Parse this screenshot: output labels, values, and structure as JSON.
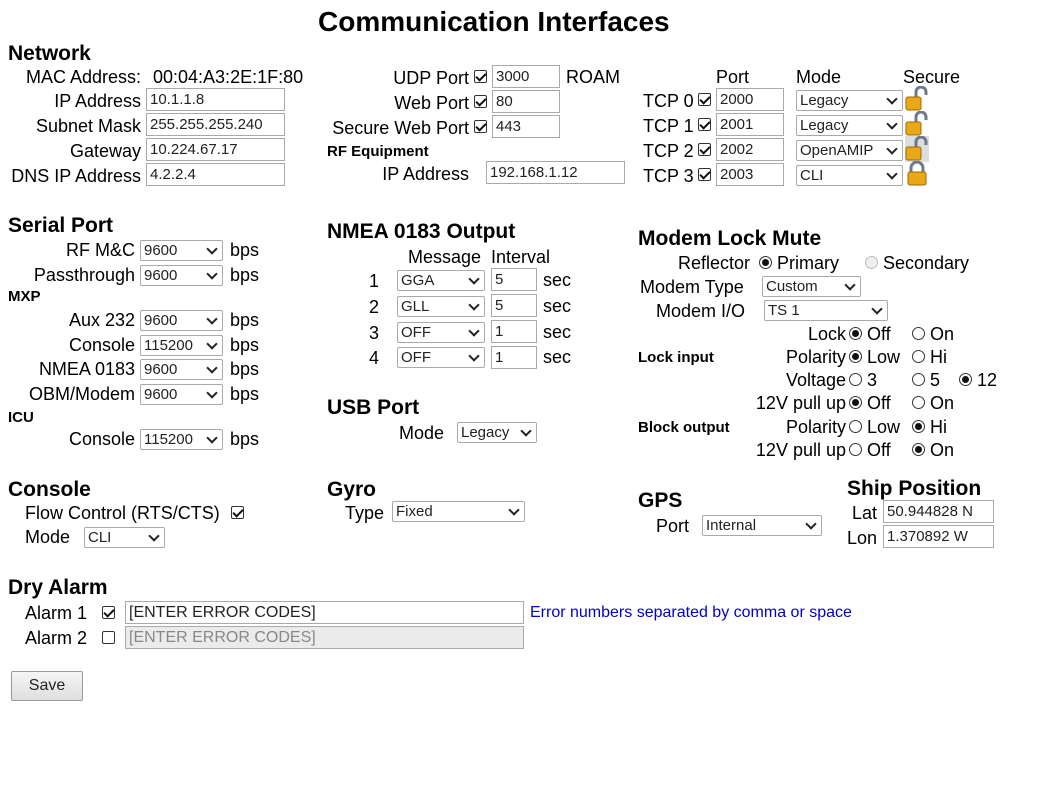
{
  "title": "Communication Interfaces",
  "network": {
    "heading": "Network",
    "mac_label": "MAC Address:",
    "mac_value": "00:04:A3:2E:1F:80",
    "ip_label": "IP Address",
    "ip_value": "10.1.1.8",
    "subnet_label": "Subnet Mask",
    "subnet_value": "255.255.255.240",
    "gateway_label": "Gateway",
    "gateway_value": "10.224.67.17",
    "dns_label": "DNS IP Address",
    "dns_value": "4.2.2.4",
    "udp_label": "UDP Port",
    "udp_value": "3000",
    "udp_checked": true,
    "roam_label": "ROAM",
    "web_label": "Web Port",
    "web_value": "80",
    "web_checked": true,
    "secure_web_label": "Secure Web Port",
    "secure_web_value": "443",
    "secure_web_checked": true,
    "rf_heading": "RF Equipment",
    "rf_ip_label": "IP Address",
    "rf_ip_value": "192.168.1.12"
  },
  "tcp": {
    "port_header": "Port",
    "mode_header": "Mode",
    "secure_header": "Secure",
    "rows": [
      {
        "label": "TCP 0",
        "checked": true,
        "port": "2000",
        "mode": "Legacy",
        "lock_icon": "unlocked-icon"
      },
      {
        "label": "TCP 1",
        "checked": true,
        "port": "2001",
        "mode": "Legacy",
        "lock_icon": "unlocked-icon"
      },
      {
        "label": "TCP 2",
        "checked": true,
        "port": "2002",
        "mode": "OpenAMIP",
        "lock_icon": "unlocked-disabled-icon"
      },
      {
        "label": "TCP 3",
        "checked": true,
        "port": "2003",
        "mode": "CLI",
        "lock_icon": "locked-icon"
      }
    ]
  },
  "serial": {
    "heading": "Serial Port",
    "rfmc_label": "RF M&C",
    "rfmc_value": "9600",
    "pass_label": "Passthrough",
    "pass_value": "9600",
    "mxp_heading": "MXP",
    "aux_label": "Aux 232",
    "aux_value": "9600",
    "console_label": "Console",
    "console_value": "115200",
    "nmea_label": "NMEA 0183",
    "nmea_value": "9600",
    "obm_label": "OBM/Modem",
    "obm_value": "9600",
    "icu_heading": "ICU",
    "icu_console_label": "Console",
    "icu_console_value": "115200",
    "unit": "bps"
  },
  "nmea": {
    "heading": "NMEA 0183 Output",
    "message_header": "Message",
    "interval_header": "Interval",
    "unit": "sec",
    "rows": [
      {
        "num": "1",
        "message": "GGA",
        "interval": "5"
      },
      {
        "num": "2",
        "message": "GLL",
        "interval": "5"
      },
      {
        "num": "3",
        "message": "OFF",
        "interval": "1"
      },
      {
        "num": "4",
        "message": "OFF",
        "interval": "1"
      }
    ]
  },
  "usb": {
    "heading": "USB Port",
    "mode_label": "Mode",
    "mode_value": "Legacy"
  },
  "modem_lock": {
    "heading": "Modem Lock Mute",
    "reflector_label": "Reflector",
    "primary_label": "Primary",
    "secondary_label": "Secondary",
    "modem_type_label": "Modem Type",
    "modem_type_value": "Custom",
    "modem_io_label": "Modem I/O",
    "modem_io_value": "TS 1",
    "lock_input_heading": "Lock input",
    "lock_label": "Lock",
    "off_label": "Off",
    "on_label": "On",
    "polarity_label": "Polarity",
    "low_label": "Low",
    "hi_label": "Hi",
    "voltage_label": "Voltage",
    "v3_label": "3",
    "v5_label": "5",
    "v12_label": "12",
    "pullup_label": "12V pull up",
    "block_output_heading": "Block output"
  },
  "console": {
    "heading": "Console",
    "flow_label": "Flow Control (RTS/CTS)",
    "flow_checked": true,
    "mode_label": "Mode",
    "mode_value": "CLI"
  },
  "gyro": {
    "heading": "Gyro",
    "type_label": "Type",
    "type_value": "Fixed"
  },
  "gps": {
    "heading": "GPS",
    "port_label": "Port",
    "port_value": "Internal"
  },
  "ship": {
    "heading": "Ship Position",
    "lat_label": "Lat",
    "lat_value": "50.944828 N",
    "lon_label": "Lon",
    "lon_value": "1.370892 W"
  },
  "dry_alarm": {
    "heading": "Dry Alarm",
    "alarm1_label": "Alarm 1",
    "alarm1_checked": true,
    "alarm1_value": "[ENTER ERROR CODES]",
    "alarm2_label": "Alarm 2",
    "alarm2_checked": false,
    "alarm2_value": "[ENTER ERROR CODES]",
    "note": "Error numbers separated by comma or space"
  },
  "save_label": "Save"
}
